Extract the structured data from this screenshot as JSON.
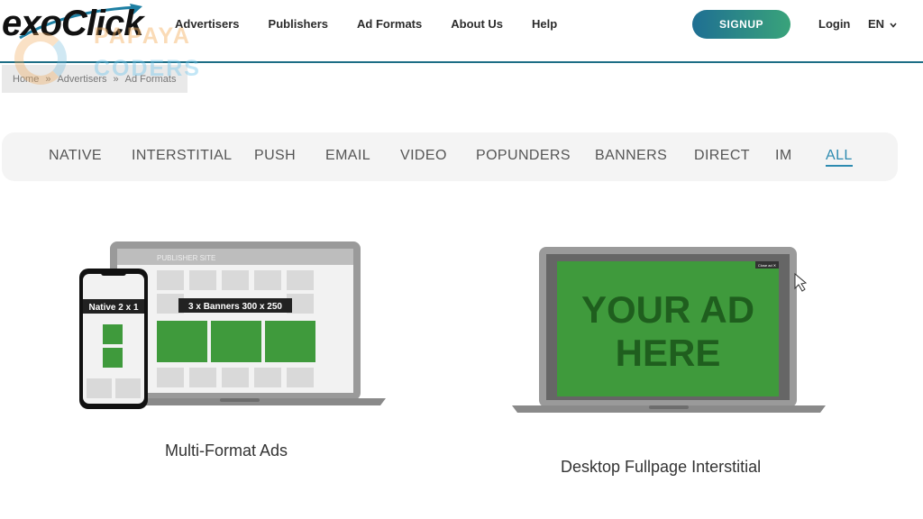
{
  "header": {
    "logo": "exoClick",
    "nav": [
      "Advertisers",
      "Publishers",
      "Ad Formats",
      "About Us",
      "Help"
    ],
    "signup": "SIGNUP",
    "login": "Login",
    "lang": "EN"
  },
  "watermark": {
    "line1": "PAPAYA",
    "line2": "CODERS"
  },
  "breadcrumb": [
    "Home",
    "Advertisers",
    "Ad Formats"
  ],
  "breadcrumb_sep": "»",
  "tabs": [
    "NATIVE",
    "INTERSTITIAL",
    "PUSH",
    "EMAIL",
    "VIDEO",
    "POPUNDERS",
    "BANNERS",
    "DIRECT",
    "IM",
    "ALL"
  ],
  "active_tab": "ALL",
  "cards": [
    {
      "title": "Multi-Format Ads",
      "publisher_site": "PUBLISHER SITE",
      "banner_label": "3 x Banners 300 x 250",
      "native_label": "Native 2 x 1"
    },
    {
      "title": "Desktop Fullpage Interstitial",
      "ad_text_line1": "YOUR AD",
      "ad_text_line2": "HERE",
      "close_label": "Close ad ✕"
    }
  ],
  "colors": {
    "accent": "#2d8bb0",
    "ad_green": "#3f9a3c",
    "ad_text": "#1f5e1e"
  }
}
